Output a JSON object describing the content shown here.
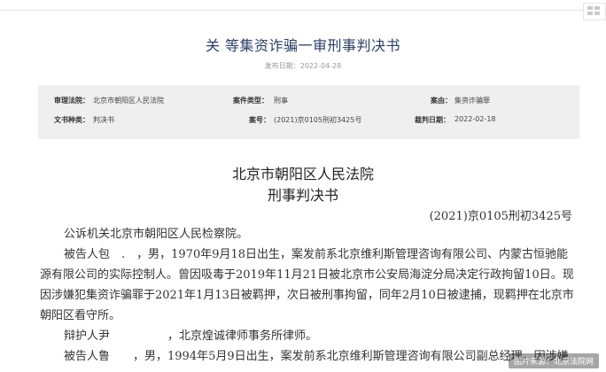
{
  "header": {
    "title": "关 等集资诈骗一审刑事判决书",
    "publish_date": "发布日期：2022-04-28"
  },
  "meta": {
    "court_label": "审理法院：",
    "court_value": "北京市朝阳区人民法院",
    "case_type_label": "案件类型：",
    "case_type_value": "刑事",
    "cause_label": "案由：",
    "cause_value": "集资诈骗罪",
    "doc_type_label": "文书种类：",
    "doc_type_value": "判决书",
    "case_no_label": "案号：",
    "case_no_value": "(2021)京0105刑初3425号",
    "verdict_date_label": "裁判日期：",
    "verdict_date_value": "2022-02-18"
  },
  "document": {
    "court_name": "北京市朝阳区人民法院",
    "doc_type": "刑事判决书",
    "case_number": "(2021)京0105刑初3425号",
    "paragraphs": [
      "公诉机关北京市朝阳区人民检察院。",
      "被告人包　.　，男，1970年9月18日出生，案发前系北京维利斯管理咨询有限公司、内蒙古恒驰能",
      "源有限公司的实际控制人。曾因吸毒于2019年11月21日被北京市公安局海淀分局决定行政拘留10日。现",
      "因涉嫌犯集资诈骗罪于2021年1月13日被羁押，次日被刑事拘留，同年2月10日被逮捕，现羁押在北京市",
      "朝阳区看守所。",
      "辩护人尹　　　　　，北京煌诚律师事务所律师。",
      "被告人鲁　　，男，1994年5月9日出生，案发前系北京维利斯管理咨询有限公司副总经理。因涉嫌"
    ]
  },
  "watermark": "图片来源：北京法院网",
  "icons": {
    "corner": "grid-icon"
  }
}
